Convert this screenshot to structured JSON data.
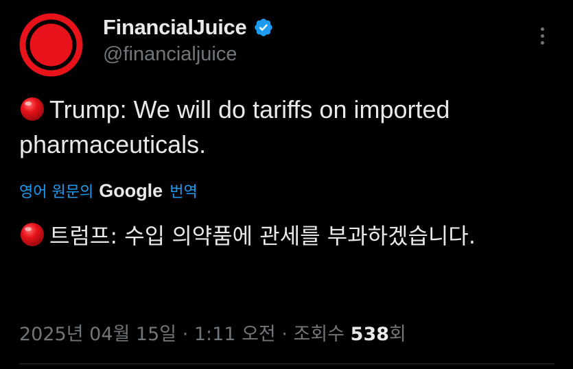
{
  "author": {
    "display_name": "FinancialJuice",
    "handle": "@financialjuice",
    "verified": true,
    "avatar_icon": "red-circle-logo",
    "colors": {
      "avatar_red": "#e8121a",
      "verified_blue": "#1d9bf0"
    }
  },
  "tweet": {
    "bullet_icon": "red-circle-emoji",
    "text": "Trump: We will do tariffs on imported pharmaceuticals."
  },
  "translation": {
    "link_prefix": "영어 원문의",
    "brand": "Google",
    "link_suffix": "번역",
    "bullet_icon": "red-circle-emoji",
    "text": "트럼프: 수입 의약품에 관세를 부과하겠습니다."
  },
  "meta": {
    "date": "2025년 04월 15일",
    "separator": " · ",
    "time": "1:11 오전",
    "views_label": "조회수",
    "views_count": "538",
    "views_suffix": "회"
  },
  "menu": {
    "icon": "more-vertical-icon"
  },
  "colors": {
    "background": "#000000",
    "primary_text": "#e7e9ea",
    "secondary_text": "#71767b",
    "link": "#1d9bf0"
  }
}
